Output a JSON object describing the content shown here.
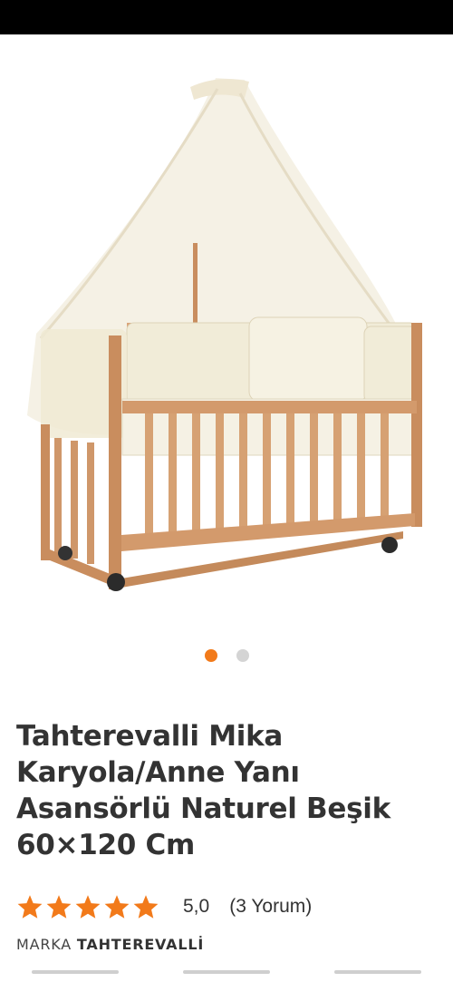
{
  "gallery": {
    "image_name": "product-photo",
    "dot_count": 2,
    "active_index": 0,
    "accent": "#f27a1a"
  },
  "product": {
    "title": "Tahterevalli Mika Karyola/Anne Yanı Asansörlü Naturel Beşik 60×120 Cm",
    "rating_score": "5,0",
    "review_label": "(3 Yorum)",
    "stars": 5,
    "star_color": "#f27a1a",
    "brand_label": "MARKA",
    "brand_name": "TAHTEREVALLİ"
  }
}
